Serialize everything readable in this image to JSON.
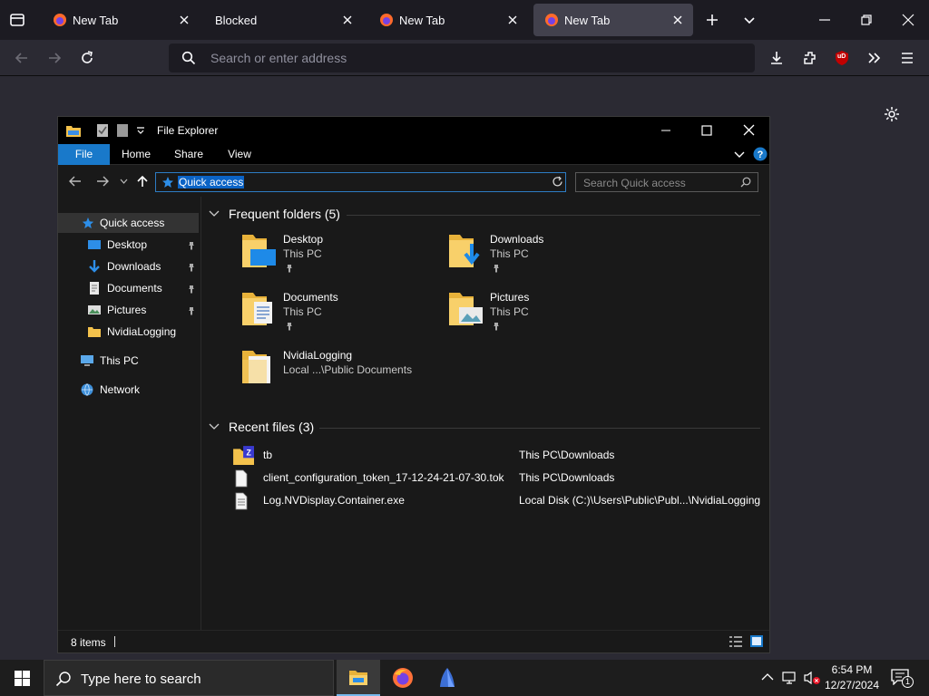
{
  "browser": {
    "tabs": [
      {
        "label": "New Tab"
      },
      {
        "label": "Blocked"
      },
      {
        "label": "New Tab"
      },
      {
        "label": "New Tab"
      }
    ],
    "url_placeholder": "Search or enter address",
    "ublock_badge": "uD"
  },
  "explorer": {
    "title": "File Explorer",
    "ribbon_tabs": [
      "File",
      "Home",
      "Share",
      "View"
    ],
    "address": "Quick access",
    "search_placeholder": "Search Quick access",
    "nav": {
      "quick_access": "Quick access",
      "items": [
        "Desktop",
        "Downloads",
        "Documents",
        "Pictures",
        "NvidiaLogging"
      ],
      "this_pc": "This PC",
      "network": "Network"
    },
    "frequent_header": "Frequent folders (5)",
    "frequent": [
      {
        "name": "Desktop",
        "location": "This PC"
      },
      {
        "name": "Downloads",
        "location": "This PC"
      },
      {
        "name": "Documents",
        "location": "This PC"
      },
      {
        "name": "Pictures",
        "location": "This PC"
      },
      {
        "name": "NvidiaLogging",
        "location": "Local ...\\Public Documents"
      }
    ],
    "recent_header": "Recent files (3)",
    "recent": [
      {
        "name": "tb",
        "location": "This PC\\Downloads"
      },
      {
        "name": "client_configuration_token_17-12-24-21-07-30.tok",
        "location": "This PC\\Downloads"
      },
      {
        "name": "Log.NVDisplay.Container.exe",
        "location": "Local Disk (C:)\\Users\\Public\\Publ...\\NvidiaLogging"
      }
    ],
    "status": "8 items"
  },
  "taskbar": {
    "search_placeholder": "Type here to search",
    "time": "6:54 PM",
    "date": "12/27/2024",
    "notification_count": "1"
  },
  "colors": {
    "accent": "#1979ca",
    "selection": "#0b63c5",
    "tab_active": "#42414d"
  }
}
